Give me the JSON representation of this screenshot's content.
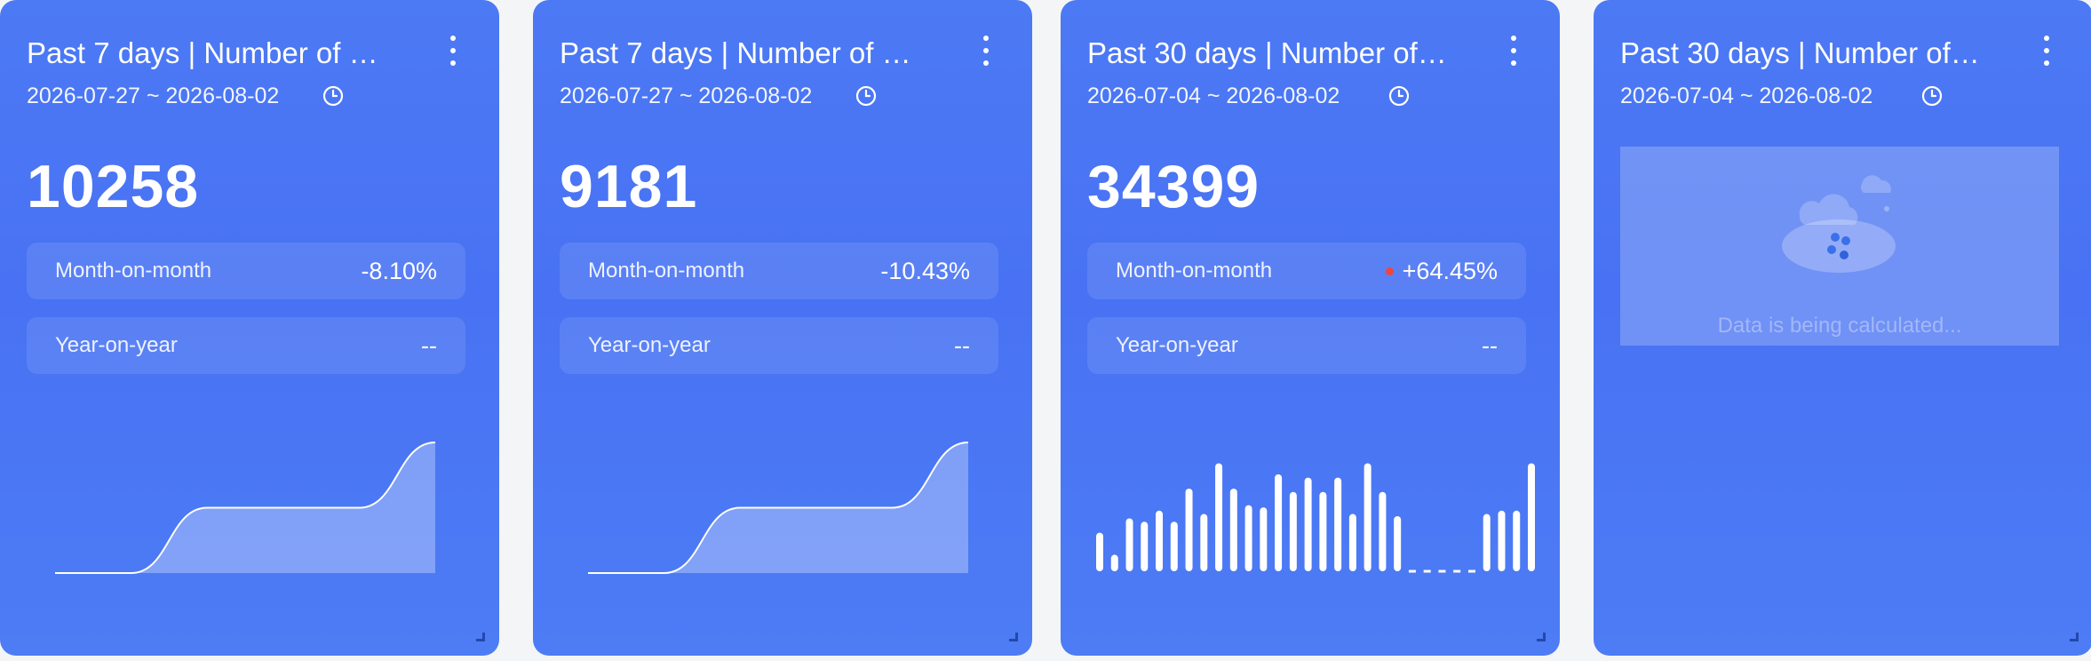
{
  "cards": [
    {
      "title": "Past 7 days | Number of …",
      "date_range": "2026-07-27 ~ 2026-08-02",
      "value": "10258",
      "mom_label": "Month-on-month",
      "mom_value": "-8.10%",
      "yoy_label": "Year-on-year",
      "yoy_value": "--"
    },
    {
      "title": "Past 7 days | Number of …",
      "date_range": "2026-07-27 ~ 2026-08-02",
      "value": "9181",
      "mom_label": "Month-on-month",
      "mom_value": "-10.43%",
      "yoy_label": "Year-on-year",
      "yoy_value": "--"
    },
    {
      "title": "Past 30 days | Number of…",
      "date_range": "2026-07-04 ~ 2026-08-02",
      "value": "34399",
      "mom_label": "Month-on-month",
      "mom_value": "+64.45%",
      "yoy_label": "Year-on-year",
      "yoy_value": "--"
    },
    {
      "title": "Past 30 days | Number of…",
      "date_range": "2026-07-04 ~ 2026-08-02",
      "calculating_text": "Data is being calculated..."
    }
  ],
  "icons": {
    "more": "more-vertical-icon",
    "clock": "clock-icon",
    "resize": "resize-handle-icon"
  },
  "colors": {
    "card_bg": "#4a76f4",
    "up_indicator": "#f0453b"
  },
  "chart_data": [
    {
      "type": "area",
      "values": [
        0,
        0,
        0.5,
        0.5,
        0.5,
        1.0
      ],
      "xlabel": "",
      "ylabel": ""
    },
    {
      "type": "area",
      "values": [
        0,
        0,
        0.5,
        0.5,
        0.5,
        1.0
      ],
      "xlabel": "",
      "ylabel": ""
    },
    {
      "type": "bar",
      "values": [
        0.35,
        0.15,
        0.48,
        0.45,
        0.55,
        0.45,
        0.75,
        0.52,
        0.98,
        0.75,
        0.6,
        0.58,
        0.88,
        0.72,
        0.85,
        0.72,
        0.85,
        0.52,
        0.98,
        0.72,
        0.5,
        0,
        0,
        0,
        0,
        0,
        0.52,
        0.55,
        0.55,
        0.98
      ],
      "xlabel": "",
      "ylabel": ""
    }
  ]
}
